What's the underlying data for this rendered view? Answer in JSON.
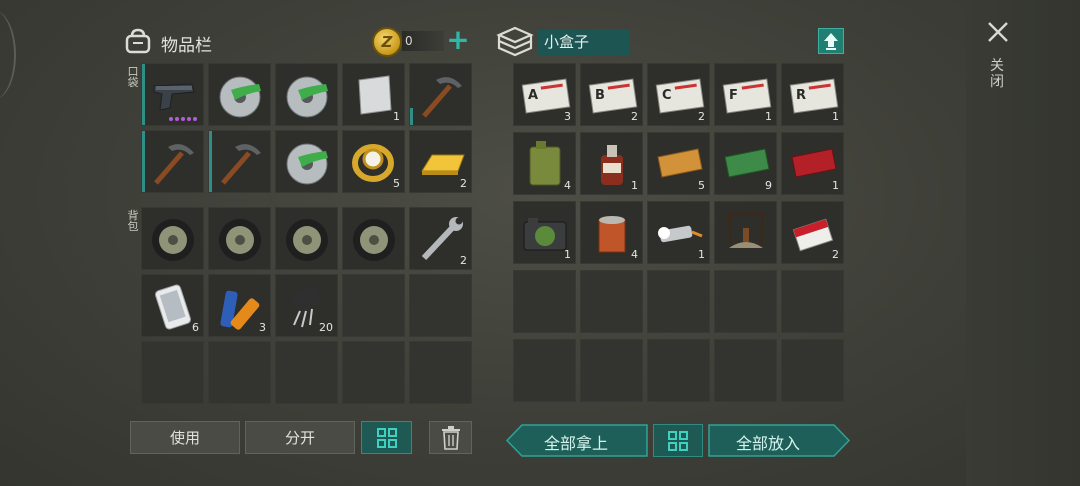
{
  "inventory": {
    "title": "物品栏",
    "coin_count": "0",
    "coin_symbol": "Z",
    "plus_label": "+",
    "pocket_label": "口袋",
    "backpack_label": "背包",
    "pocket_slots": [
      {
        "item": "pistol-icon",
        "count": ""
      },
      {
        "item": "sawblade-icon",
        "count": ""
      },
      {
        "item": "sawblade-icon",
        "count": ""
      },
      {
        "item": "metal-sheet-icon",
        "count": "1"
      },
      {
        "item": "pickaxe-icon",
        "count": ""
      },
      {
        "item": "pickaxe-icon",
        "count": ""
      },
      {
        "item": "pickaxe-icon",
        "count": ""
      },
      {
        "item": "sawblade-icon",
        "count": ""
      },
      {
        "item": "gold-watch-icon",
        "count": "5"
      },
      {
        "item": "gold-bar-icon",
        "count": "2"
      }
    ],
    "backpack_slots": [
      {
        "item": "wheel-icon",
        "count": ""
      },
      {
        "item": "wheel-icon",
        "count": ""
      },
      {
        "item": "wheel-icon",
        "count": ""
      },
      {
        "item": "wheel-icon",
        "count": ""
      },
      {
        "item": "wrench-icon",
        "count": "2"
      },
      {
        "item": "smartphone-icon",
        "count": "6"
      },
      {
        "item": "batteries-icon",
        "count": "3"
      },
      {
        "item": "transistor-icon",
        "count": "20"
      },
      {
        "item": "",
        "count": ""
      },
      {
        "item": "",
        "count": ""
      },
      {
        "item": "",
        "count": ""
      },
      {
        "item": "",
        "count": ""
      },
      {
        "item": "",
        "count": ""
      },
      {
        "item": "",
        "count": ""
      },
      {
        "item": "",
        "count": ""
      }
    ],
    "use_label": "使用",
    "split_label": "分开"
  },
  "box": {
    "title": "小盒子",
    "slots": [
      {
        "item": "army-card-a-icon",
        "letter": "A",
        "count": "3"
      },
      {
        "item": "army-card-b-icon",
        "letter": "B",
        "count": "2"
      },
      {
        "item": "army-card-c-icon",
        "letter": "C",
        "count": "2"
      },
      {
        "item": "army-card-f-icon",
        "letter": "F",
        "count": "1"
      },
      {
        "item": "army-card-r-icon",
        "letter": "R",
        "count": "1"
      },
      {
        "item": "jerrycan-icon",
        "count": "4"
      },
      {
        "item": "bottle-icon",
        "count": "1"
      },
      {
        "item": "coupon-yellow-icon",
        "count": "5"
      },
      {
        "item": "coupon-green-icon",
        "count": "9"
      },
      {
        "item": "coupon-red-icon",
        "count": "1"
      },
      {
        "item": "camera-icon",
        "count": "1"
      },
      {
        "item": "tin-can-icon",
        "count": "4"
      },
      {
        "item": "flashlight-icon",
        "count": "1"
      },
      {
        "item": "campfire-icon",
        "count": ""
      },
      {
        "item": "cigarettes-icon",
        "count": "2"
      }
    ],
    "take_all_label": "全部拿上",
    "put_all_label": "全部放入"
  },
  "close_label": "关闭",
  "colors": {
    "accent": "#2fb7a8",
    "teal_dark": "#1f5954",
    "purple_rarity": "#b45cd8"
  }
}
